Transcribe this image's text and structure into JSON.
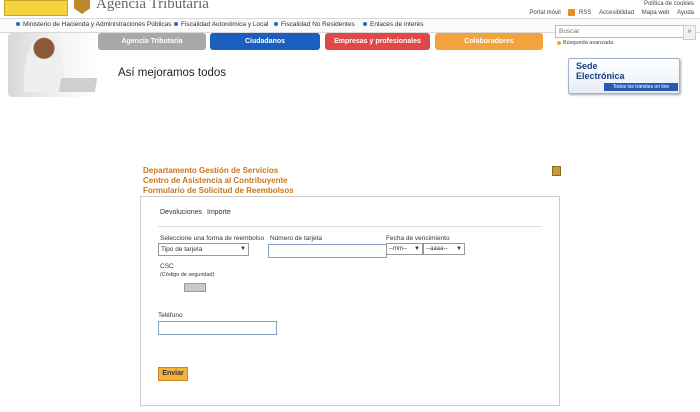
{
  "header": {
    "agency_name": "Agencia Tributaria",
    "top_right_row1": "Política de cookies",
    "top_links": [
      "Portal móvil",
      "RSS",
      "Accesibilidad",
      "Mapa web",
      "Ayuda"
    ]
  },
  "nav_links": [
    "Ministerio de Hacienda y Administraciones Públicas",
    "Fiscalidad Autonómica y Local",
    "Fiscalidad No Residentes",
    "Enlaces de interés"
  ],
  "tabs": [
    "Agencia Tributaria",
    "Ciudadanos",
    "Empresas y profesionales",
    "Colaboradores"
  ],
  "slogan": "Así mejoramos todos",
  "search": {
    "placeholder": "Buscar",
    "advanced": "Búsqueda avanzada",
    "button": "»"
  },
  "sede": {
    "line1": "Sede",
    "line2": "Electrónica",
    "tagline": "Todos los trámites on line"
  },
  "department": {
    "line1": "Departamento Gestión de Servicios",
    "line2": "Centro de Asistencia al Contribuyente",
    "line3": "Formulario de Solicitud de Reembolsos"
  },
  "form": {
    "tab1": "Devoluciones",
    "tab2": "Importe",
    "card_type_label": "Seleccione una forma de reembolso",
    "card_type_value": "Tipo de tarjeta",
    "card_number_label": "Número de tarjeta",
    "expiry_label": "Fecha de vencimiento",
    "month_value": "--mm--",
    "year_value": "--aaaa--",
    "cvv_label": "CSC",
    "cvv_hint": "(Código de seguridad)",
    "phone_label": "Teléfono",
    "submit": "Enviar"
  },
  "colors": {
    "accent_orange": "#c8761a",
    "tab_blue": "#1a5fc0",
    "tab_red": "#e04848",
    "tab_yellow": "#f3a33d",
    "tab_grey": "#a8a8a8"
  }
}
